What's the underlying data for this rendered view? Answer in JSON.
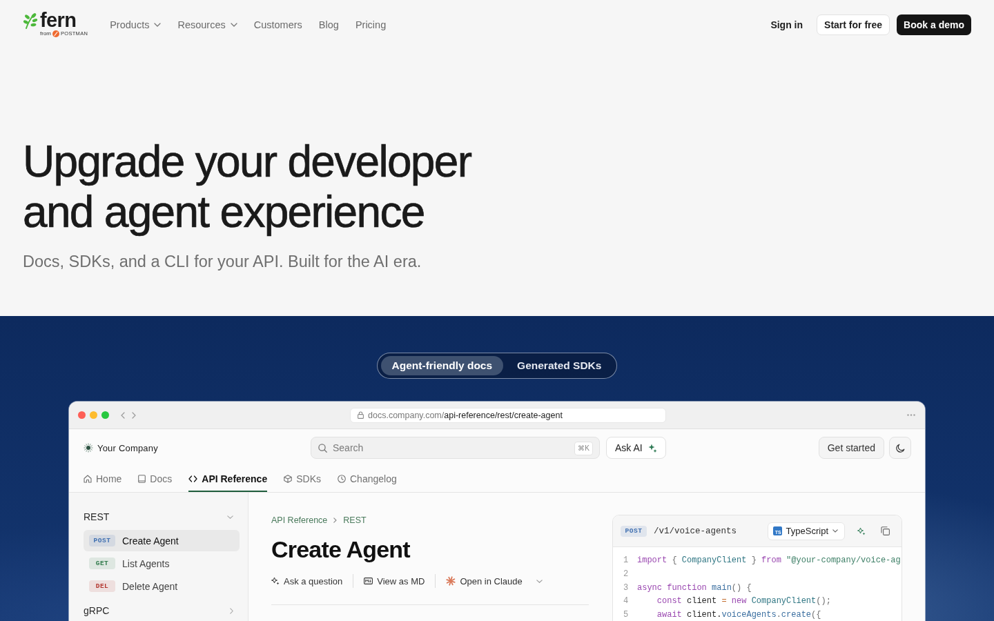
{
  "header": {
    "logo": {
      "wordmark": "fern",
      "byline": "from",
      "partner": "POSTMAN"
    },
    "nav": [
      {
        "label": "Products",
        "has_menu": true
      },
      {
        "label": "Resources",
        "has_menu": true
      },
      {
        "label": "Customers",
        "has_menu": false
      },
      {
        "label": "Blog",
        "has_menu": false
      },
      {
        "label": "Pricing",
        "has_menu": false
      }
    ],
    "actions": [
      {
        "label": "Sign in",
        "kind": "link"
      },
      {
        "label": "Start for free",
        "kind": "outline"
      },
      {
        "label": "Book a demo",
        "kind": "primary"
      }
    ]
  },
  "hero": {
    "title": "Upgrade your developer and agent experience",
    "subtitle": "Docs, SDKs, and a CLI for your API. Built for the AI era."
  },
  "showcase": {
    "toggle": [
      {
        "label": "Agent-friendly docs",
        "selected": true
      },
      {
        "label": "Generated SDKs",
        "selected": false
      }
    ],
    "browser": {
      "url": {
        "host": "docs.company.com/",
        "path": "api-reference/rest/create-agent"
      },
      "docs": {
        "company": "Your Company",
        "search": {
          "placeholder": "Search",
          "shortcut": "⌘K"
        },
        "ask_ai": "Ask AI",
        "get_started": "Get started",
        "tabs": [
          {
            "label": "Home",
            "kind": "home",
            "selected": false
          },
          {
            "label": "Docs",
            "kind": "guides",
            "selected": false
          },
          {
            "label": "API Reference",
            "kind": "reference",
            "selected": true
          },
          {
            "label": "SDKs",
            "kind": "sdks",
            "selected": false
          },
          {
            "label": "Changelog",
            "kind": "changelog",
            "selected": false
          }
        ],
        "sidebar": [
          {
            "title": "REST",
            "expanded": true,
            "items": [
              {
                "method": "POST",
                "color": "#3f6fb0",
                "label": "Create Agent",
                "selected": true
              },
              {
                "method": "GET",
                "color": "#2f7a4a",
                "label": "List Agents",
                "selected": false
              },
              {
                "method": "DEL",
                "color": "#b3362f",
                "label": "Delete Agent",
                "selected": false
              }
            ]
          },
          {
            "title": "gRPC",
            "expanded": false
          }
        ],
        "breadcrumb": [
          "API Reference",
          "REST"
        ],
        "title": "Create Agent",
        "actions": [
          {
            "label": "Ask a question",
            "kind": "ask",
            "has_menu": false
          },
          {
            "label": "View as MD",
            "kind": "markdown",
            "has_menu": false
          },
          {
            "label": "Open in Claude",
            "kind": "claude",
            "has_menu": true
          }
        ],
        "code": {
          "method": "POST",
          "color": "#3f6fb0",
          "path": "/v1/voice-agents",
          "language_badge": "TS",
          "language": "TypeScript",
          "lines": [
            {
              "number": "1",
              "tokens": [
                {
                  "kind": "keyword",
                  "text": "import"
                },
                {
                  "kind": "punct",
                  "text": " { "
                },
                {
                  "kind": "type",
                  "text": "CompanyClient"
                },
                {
                  "kind": "punct",
                  "text": " } "
                },
                {
                  "kind": "keyword",
                  "text": "from "
                },
                {
                  "kind": "string",
                  "text": "\"@your-company/voice-ag"
                }
              ]
            },
            {
              "number": "2"
            },
            {
              "number": "3",
              "tokens": [
                {
                  "kind": "keyword",
                  "text": "async function "
                },
                {
                  "kind": "func",
                  "text": "main"
                },
                {
                  "kind": "punct",
                  "text": "() {"
                }
              ]
            },
            {
              "number": "4",
              "tokens": [
                {
                  "kind": "keyword",
                  "text": "    const "
                },
                {
                  "kind": "plain",
                  "text": "client "
                },
                {
                  "kind": "operator",
                  "text": "= "
                },
                {
                  "kind": "keyword",
                  "text": "new "
                },
                {
                  "kind": "type",
                  "text": "CompanyClient"
                },
                {
                  "kind": "punct",
                  "text": "();"
                }
              ]
            },
            {
              "number": "5",
              "tokens": [
                {
                  "kind": "keyword",
                  "text": "    await "
                },
                {
                  "kind": "plain",
                  "text": "client."
                },
                {
                  "kind": "func",
                  "text": "voiceAgents"
                },
                {
                  "kind": "punct",
                  "text": "."
                },
                {
                  "kind": "func",
                  "text": "create"
                },
                {
                  "kind": "punct",
                  "text": "({"
                }
              ]
            }
          ]
        }
      }
    }
  }
}
